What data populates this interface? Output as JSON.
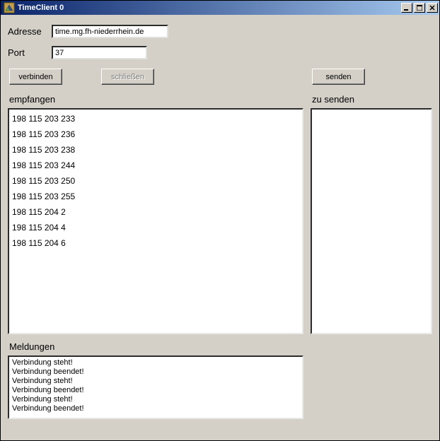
{
  "window": {
    "title": "TimeClient 0"
  },
  "fields": {
    "address_label": "Adresse",
    "address_value": "time.mg.fh-niederrhein.de",
    "port_label": "Port",
    "port_value": "37"
  },
  "buttons": {
    "connect": "verbinden",
    "close": "schließen",
    "send": "senden"
  },
  "sections": {
    "received": "empfangen",
    "to_send": "zu senden",
    "messages": "Meldungen"
  },
  "received_items": [
    "198 115 203 233",
    "198 115 203 236",
    "198 115 203 238",
    "198 115 203 244",
    "198 115 203 250",
    "198 115 203 255",
    "198 115 204 2",
    "198 115 204 4",
    "198 115 204 6"
  ],
  "to_send_items": [],
  "messages_items": [
    "Verbindung steht!",
    "Verbindung beendet!",
    "Verbindung steht!",
    "Verbindung beendet!",
    "Verbindung steht!",
    "Verbindung beendet!"
  ]
}
